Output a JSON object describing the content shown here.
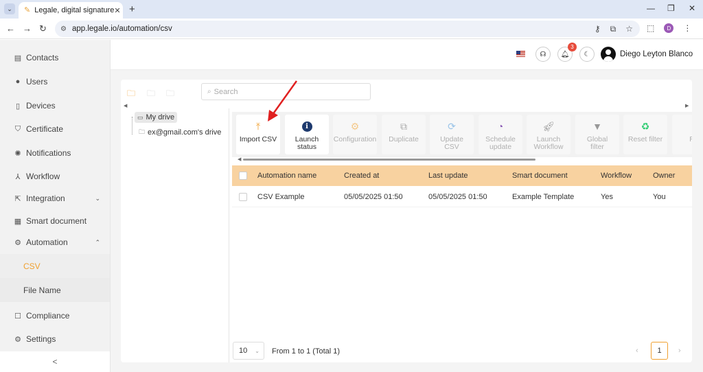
{
  "browser": {
    "tab_title": "Legale, digital signature",
    "url": "app.legale.io/automation/csv",
    "profile_initial": "D"
  },
  "sidebar": {
    "items": [
      {
        "label": "Contacts",
        "icon": "contacts-icon"
      },
      {
        "label": "Users",
        "icon": "user-icon"
      },
      {
        "label": "Devices",
        "icon": "tablet-icon"
      },
      {
        "label": "Certificate",
        "icon": "shield-icon"
      },
      {
        "label": "Notifications",
        "icon": "broadcast-icon"
      },
      {
        "label": "Workflow",
        "icon": "workflow-icon"
      },
      {
        "label": "Integration",
        "icon": "external-link-icon"
      },
      {
        "label": "Smart document",
        "icon": "layout-icon"
      },
      {
        "label": "Automation",
        "icon": "gear-icon"
      },
      {
        "label": "Compliance",
        "icon": "comment-icon"
      },
      {
        "label": "Settings",
        "icon": "settings-icon"
      }
    ],
    "sub_items": [
      "CSV",
      "File Name"
    ],
    "collapse": "<"
  },
  "header": {
    "notification_count": "3",
    "user_name": "Diego Leyton Blanco"
  },
  "search": {
    "placeholder": "Search"
  },
  "tree": {
    "my_drive": "My drive",
    "shared_drive": "ex@gmail.com's drive"
  },
  "toolbar": [
    {
      "label": "Import CSV",
      "enabled": true
    },
    {
      "label": "Launch status",
      "enabled": true
    },
    {
      "label": "Configuration",
      "enabled": false
    },
    {
      "label": "Duplicate",
      "enabled": false
    },
    {
      "label": "Update CSV",
      "enabled": false
    },
    {
      "label": "Schedule update",
      "enabled": false
    },
    {
      "label": "Launch Workflow",
      "enabled": false
    },
    {
      "label": "Global filter",
      "enabled": false
    },
    {
      "label": "Reset filter",
      "enabled": false
    },
    {
      "label": "Re",
      "enabled": false
    }
  ],
  "table": {
    "columns": [
      "Automation name",
      "Created at",
      "Last update",
      "Smart document",
      "Workflow",
      "Owner"
    ],
    "rows": [
      [
        "CSV Example",
        "05/05/2025 01:50",
        "05/05/2025 01:50",
        "Example Template",
        "Yes",
        "You"
      ]
    ]
  },
  "pagination": {
    "page_size": "10",
    "range_text": "From 1 to 1 (Total 1)",
    "current_page": "1"
  },
  "colors": {
    "accent": "#f0a030",
    "table_header": "#f8d2a0",
    "annotation_arrow": "#e02020"
  }
}
